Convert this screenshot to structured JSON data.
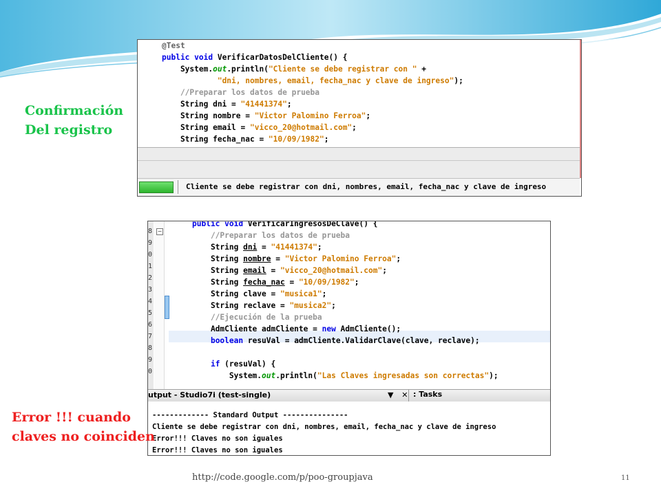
{
  "slide": {
    "footer_link": "http://code.google.com/p/poo-groupjava",
    "page_number": "11"
  },
  "labels": {
    "confirm_line1": "Confirmación",
    "confirm_line2": "Del registro",
    "error_line1": "Error !!! cuando",
    "error_line2": "claves no coinciden"
  },
  "colors": {
    "label_green": "#19c34a",
    "label_red": "#ee2020",
    "keyword_blue": "#0000e6",
    "string_orange": "#ce7b00",
    "comment_gray": "#969696"
  },
  "screenshot1": {
    "code": [
      [
        {
          "t": "@Test",
          "c": "ann"
        }
      ],
      [
        {
          "t": "public void ",
          "c": "kw"
        },
        {
          "t": "VerificarDatosDelCliente",
          "c": "fn"
        },
        {
          "t": "() {",
          "c": "plain"
        }
      ],
      [
        {
          "t": "    System.",
          "c": "plain"
        },
        {
          "t": "out",
          "c": "it"
        },
        {
          "t": ".println(",
          "c": "plain"
        },
        {
          "t": "\"Cliente se debe registrar con \"",
          "c": "str"
        },
        {
          "t": " +",
          "c": "plain"
        }
      ],
      [
        {
          "t": "            ",
          "c": "plain"
        },
        {
          "t": "\"dni, nombres, email, fecha_nac y clave de ingreso\"",
          "c": "str"
        },
        {
          "t": ");",
          "c": "plain"
        }
      ],
      [
        {
          "t": "    //Preparar los datos de prueba",
          "c": "cmt"
        }
      ],
      [
        {
          "t": "    String dni = ",
          "c": "plain"
        },
        {
          "t": "\"41441374\"",
          "c": "str"
        },
        {
          "t": ";",
          "c": "plain"
        }
      ],
      [
        {
          "t": "    String nombre = ",
          "c": "plain"
        },
        {
          "t": "\"Victor Palomino Ferroa\"",
          "c": "str"
        },
        {
          "t": ";",
          "c": "plain"
        }
      ],
      [
        {
          "t": "    String email = ",
          "c": "plain"
        },
        {
          "t": "\"vicco_20@hotmail.com\"",
          "c": "str"
        },
        {
          "t": ";",
          "c": "plain"
        }
      ],
      [
        {
          "t": "    String fecha_nac = ",
          "c": "plain"
        },
        {
          "t": "\"10/09/1982\"",
          "c": "str"
        },
        {
          "t": ";",
          "c": "plain"
        }
      ]
    ],
    "status_text": "Cliente se debe registrar con dni, nombres, email, fecha_nac y clave de ingreso",
    "progress_percent": 100
  },
  "screenshot2": {
    "line_numbers": [
      "8",
      "9",
      "0",
      "1",
      "2",
      "3",
      "4",
      "5",
      "6",
      "7",
      "8",
      "9",
      "0"
    ],
    "code": [
      [
        {
          "t": "public void ",
          "c": "kw"
        },
        {
          "t": "VerificarIngresosDeClave",
          "c": "fn"
        },
        {
          "t": "() {",
          "c": "plain"
        }
      ],
      [
        {
          "t": "    //Preparar los datos de prueba",
          "c": "cmt"
        }
      ],
      [
        {
          "t": "    String ",
          "c": "plain"
        },
        {
          "t": "dni",
          "c": "plain u"
        },
        {
          "t": " = ",
          "c": "plain"
        },
        {
          "t": "\"41441374\"",
          "c": "str"
        },
        {
          "t": ";",
          "c": "plain"
        }
      ],
      [
        {
          "t": "    String ",
          "c": "plain"
        },
        {
          "t": "nombre",
          "c": "plain u"
        },
        {
          "t": " = ",
          "c": "plain"
        },
        {
          "t": "\"Victor Palomino Ferroa\"",
          "c": "str"
        },
        {
          "t": ";",
          "c": "plain"
        }
      ],
      [
        {
          "t": "    String ",
          "c": "plain"
        },
        {
          "t": "email",
          "c": "plain u"
        },
        {
          "t": " = ",
          "c": "plain"
        },
        {
          "t": "\"vicco_20@hotmail.com\"",
          "c": "str"
        },
        {
          "t": ";",
          "c": "plain"
        }
      ],
      [
        {
          "t": "    String ",
          "c": "plain"
        },
        {
          "t": "fecha_nac",
          "c": "plain u"
        },
        {
          "t": " = ",
          "c": "plain"
        },
        {
          "t": "\"10/09/1982\"",
          "c": "str"
        },
        {
          "t": ";",
          "c": "plain"
        }
      ],
      [
        {
          "t": "    String clave = ",
          "c": "plain"
        },
        {
          "t": "\"musica1\"",
          "c": "str"
        },
        {
          "t": ";",
          "c": "plain"
        }
      ],
      [
        {
          "t": "    String reclave = ",
          "c": "plain"
        },
        {
          "t": "\"musica2\"",
          "c": "str"
        },
        {
          "t": ";",
          "c": "plain"
        }
      ],
      [
        {
          "t": "    //Ejecución de la prueba",
          "c": "cmt"
        }
      ],
      [
        {
          "t": "    AdmCliente admCliente = ",
          "c": "plain"
        },
        {
          "t": "new ",
          "c": "kw"
        },
        {
          "t": "AdmCliente();",
          "c": "plain"
        }
      ],
      [
        {
          "t": "    ",
          "c": "plain"
        },
        {
          "t": "boolean ",
          "c": "kw"
        },
        {
          "t": "resuVal = admCliente.ValidarClave(clave, reclave);",
          "c": "plain"
        }
      ],
      [
        {
          "t": "",
          "c": "plain"
        }
      ],
      [
        {
          "t": "    ",
          "c": "plain"
        },
        {
          "t": "if ",
          "c": "kw"
        },
        {
          "t": "(resuVal) {",
          "c": "plain"
        }
      ],
      [
        {
          "t": "        System.",
          "c": "plain"
        },
        {
          "t": "out",
          "c": "it"
        },
        {
          "t": ".println(",
          "c": "plain"
        },
        {
          "t": "\"Las Claves ingresadas son correctas\"",
          "c": "str"
        },
        {
          "t": ");",
          "c": "plain"
        }
      ]
    ],
    "output_tab_title": "utput - Studio7i (test-single)",
    "output_tab_icons": "▼ ✕",
    "tasks_tab": ": Tasks",
    "output_lines": [
      "------------- Standard Output ---------------",
      "Cliente se debe registrar con dni, nombres, email, fecha_nac y clave de ingreso",
      "Error!!! Claves no son iguales",
      "Error!!! Claves no son iguales"
    ]
  }
}
